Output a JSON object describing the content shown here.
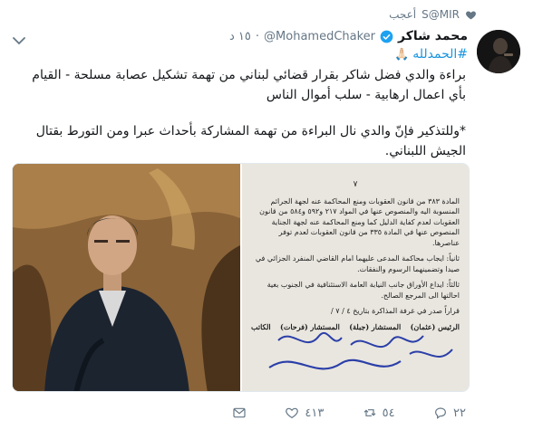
{
  "context": {
    "user": "S@MIR",
    "action": "أعجب"
  },
  "tweet": {
    "name": "محمد شاكر",
    "handle": "@MohamedChaker",
    "time": "١٥ د",
    "hashtag": "#الحمدلله",
    "hashtag_emoji": "🙏🏻",
    "text_1": "براءة والدي فضل شاكر بقرار قضائي لبناني من تهمة تشكيل عصابة مسلحة - القيام بأي اعمال ارهابية - سلب أموال الناس",
    "text_2": "*وللتذكير فإنّ والدي نال البراءة من تهمة المشاركة بأحداث عبرا ومن التورط بقتال الجيش اللبناني."
  },
  "document": {
    "page": "٧",
    "para_1": "المادة ٣٨٣ من قانون العقوبات ومنع المحاكمة عنه لجهة الجرائم المنسوبة اليه والمنصوص عنها في المواد ٢١٧ و٥٩٢ و٥٨٤ من قانون العقوبات لعدم كفاية الدليل كما ومنع المحاكمة عنه لجهة الجناية المنصوص عنها في المادة ٣٣٥ من قانون العقوبات لعدم توفر عناصرها.",
    "para_2": "ثانياً: ايجاب محاكمة المدعى عليهما امام القاضي المنفرد الجزائي في صيدا وتضمينهما الرسوم والنفقات.",
    "para_3": "ثالثاً: ايداع الأوراق جانب النيابة العامة الاستئنافية في الجنوب بغية احالتها الى المرجع الصالح.",
    "para_4": "قراراً صدر في غرفة المذاكرة بتاريخ ٤ / ٧ /",
    "sig_1": "الكاتب",
    "sig_2": "المستشار (فرحات)",
    "sig_3": "المستشار (جبلة)",
    "sig_4": "الرئيس (عثمان)"
  },
  "actions": {
    "reply_count": "٢٢",
    "retweet_count": "٥٤",
    "like_count": "٤١٣"
  },
  "colors": {
    "link": "#1b95e0",
    "muted": "#657786",
    "verified": "#1da1f2"
  },
  "icons": [
    "heart-icon",
    "chevron-down-icon",
    "verified-badge-icon",
    "reply-icon",
    "retweet-icon",
    "like-icon",
    "dm-icon"
  ]
}
